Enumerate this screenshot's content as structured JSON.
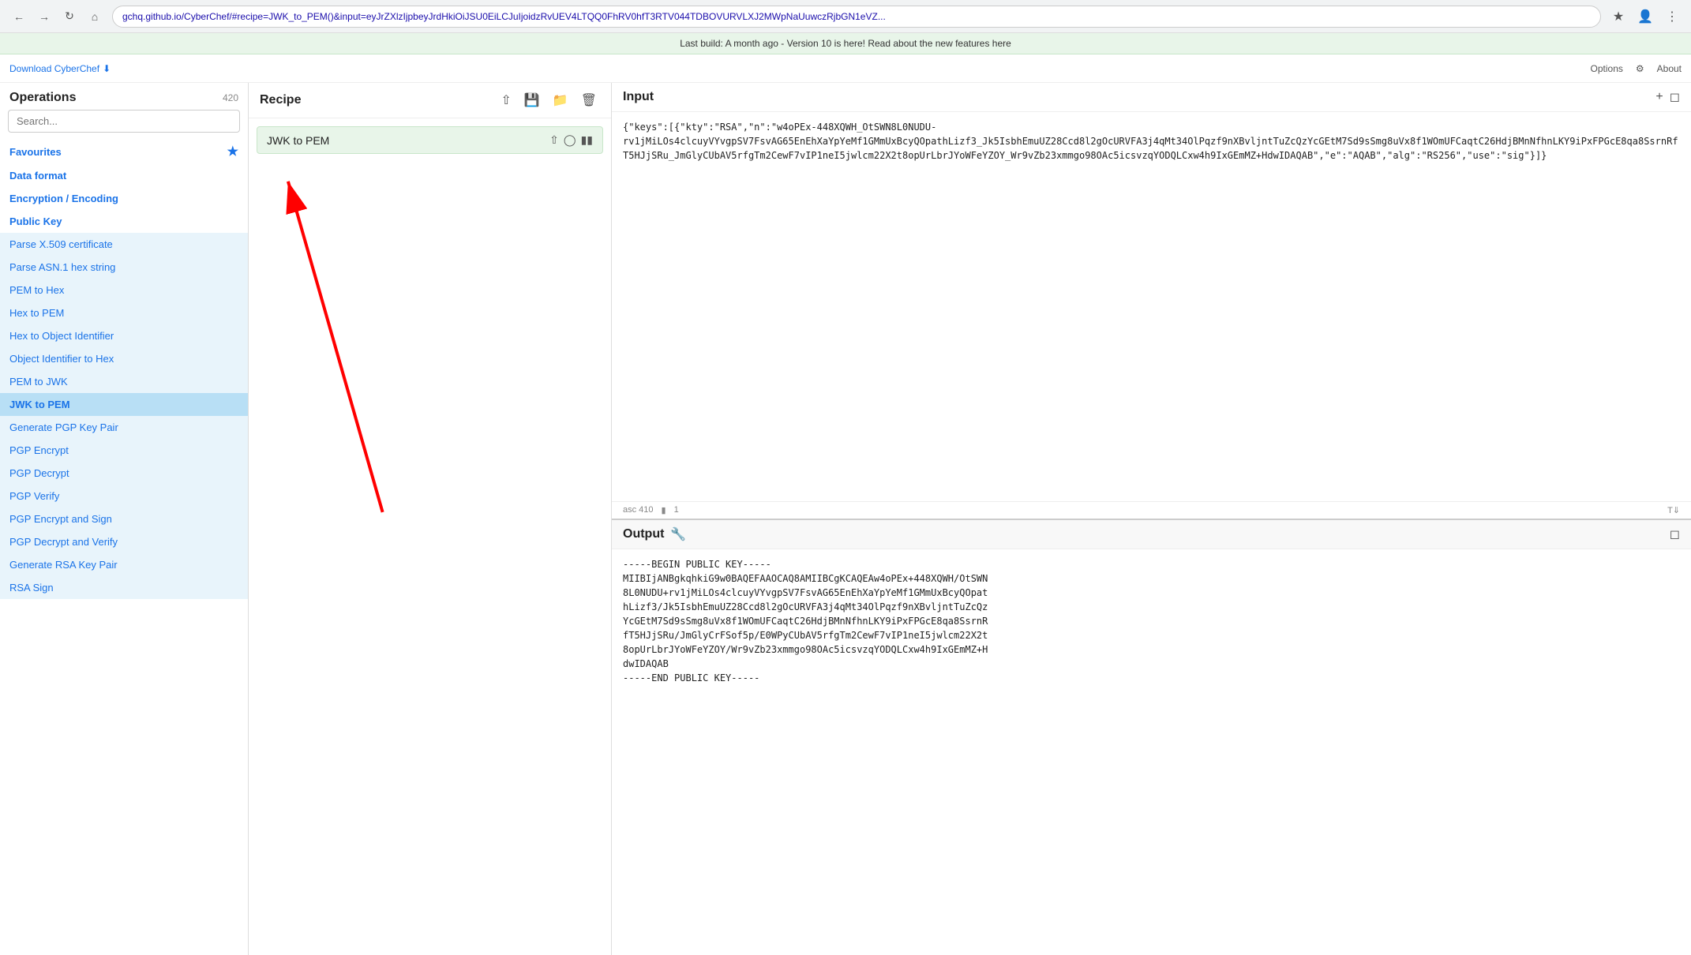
{
  "browser": {
    "address": "gchq.github.io/CyberChef/#recipe=JWK_to_PEM()&input=eyJrZXlzIjpbeyJrdHkiOiJSU0EiLCJuIjoidzRvUEV4LTQQ0FhRV0hfT3RTV044TDBOVURVLXJ2MWpNaUuwczRjbGN1eVZ..."
  },
  "notification": {
    "text": "Last build: A month ago - Version 10 is here! Read about the new features here"
  },
  "topbar": {
    "download_text": "Download CyberChef",
    "options_text": "Options",
    "about_text": "About"
  },
  "sidebar": {
    "title": "Operations",
    "count": "420",
    "search_placeholder": "Search...",
    "sections": [
      {
        "label": "Favourites",
        "type": "section"
      },
      {
        "label": "Data format",
        "type": "category"
      },
      {
        "label": "Encryption / Encoding",
        "type": "category"
      },
      {
        "label": "Public Key",
        "type": "category"
      },
      {
        "label": "Parse X.509 certificate",
        "type": "item"
      },
      {
        "label": "Parse ASN.1 hex string",
        "type": "item"
      },
      {
        "label": "PEM to Hex",
        "type": "item"
      },
      {
        "label": "Hex to PEM",
        "type": "item"
      },
      {
        "label": "Hex to Object Identifier",
        "type": "item"
      },
      {
        "label": "Object Identifier to Hex",
        "type": "item"
      },
      {
        "label": "PEM to JWK",
        "type": "item"
      },
      {
        "label": "JWK to PEM",
        "type": "item",
        "active": true
      },
      {
        "label": "Generate PGP Key Pair",
        "type": "item"
      },
      {
        "label": "PGP Encrypt",
        "type": "item"
      },
      {
        "label": "PGP Decrypt",
        "type": "item"
      },
      {
        "label": "PGP Verify",
        "type": "item"
      },
      {
        "label": "PGP Encrypt and Sign",
        "type": "item"
      },
      {
        "label": "PGP Decrypt and Verify",
        "type": "item"
      },
      {
        "label": "Generate RSA Key Pair",
        "type": "item"
      },
      {
        "label": "RSA Sign",
        "type": "item"
      }
    ]
  },
  "recipe": {
    "title": "Recipe",
    "item_label": "JWK to PEM"
  },
  "input": {
    "title": "Input",
    "value": "{\"keys\":[{\"kty\":\"RSA\",\"n\":\"w4oPEx-448XQWH_OtSWN8L0NUDU-rv1jMiLOs4clcuyVYvgpSV7FsvAG65EnEhXaYpYeMf1GMmUxBcyQOpathLizf3_Jk5IsbhEmuUZ28Ccd8l2gOcURVFA3j4qMt34OlPqzf9nXBvljntTuZcQzYcGEtM7Sd9sSmg8uVx8f1WOmUFCaqtC26HdjBMnNfhnLKY9iPxFPGcE8qa8SsrnRfT5HJjSRu_JmGlyCUbAV5rfgTm2CewF7vIP1neI5jwlcm22X2t8opUrLbrJYoWFeYZOY_Wr9vZb23xmmgo98OAc5icsvzqYODQLCxw4h9IxGEmMZ+HdwIDAQAB\",\"e\":\"AQAB\",\"alg\":\"RS256\",\"use\":\"sig\"}]}",
    "footer_chars": "asc 410",
    "footer_lines": "1"
  },
  "output": {
    "title": "Output",
    "value": "-----BEGIN PUBLIC KEY-----\nMIIBIjANBgkqhkiG9w0BAQEFAAOCAQ8AMIIBCgKCAQEAw4oPEx+448XQWH/OtSWN\n8L0NUDU+rv1jMiLOs4clcuyVYvgpSV7FsvAG65EnEhXaYpYeMf1GMmUxBcyQOpat\nhLizf3/Jk5IsbhEmuUZ28Ccd8l2gOcURVFA3j4qMt34OlPqzf9nXBvljntTuZcQz\nYcGEtM7Sd9sSmg8uVx8f1WOmUFCaqtC26HdjBMnNfhnLKY9iPxFPGcE8qa8SsrnR\nfT5HJjSRu/JmGlyCrFSof5p/E0WPyCUbAV5rfgTm2CewF7vIP1neI5jwlcm22X2t\n8opUrLbrJYoWFeYZOY/Wr9vZb23xmmgo98OAc5icsvzqYODQLCxw4h9IxGEmMZ+H\ndwIDAQAB\n-----END PUBLIC KEY-----"
  }
}
